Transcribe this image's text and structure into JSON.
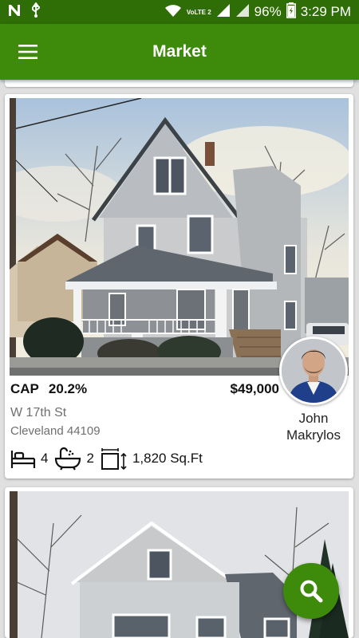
{
  "status_bar": {
    "network_label": "VoLTE 2",
    "battery": "96%",
    "time": "3:29 PM"
  },
  "app_bar": {
    "title": "Market",
    "menu_icon": "hamburger-menu-icon"
  },
  "listings": [
    {
      "cap_label": "CAP",
      "cap_value": "20.2%",
      "price": "$49,000",
      "street": "W 17th St",
      "city": "Cleveland 44109",
      "beds": "4",
      "baths": "2",
      "area": "1,820 Sq.Ft",
      "agent": {
        "first_name": "John",
        "last_name": "Makrylos"
      }
    },
    {}
  ],
  "fab": {
    "icon": "search-icon"
  },
  "colors": {
    "primary": "#3e8a0b",
    "primary_dark": "#2f6e06"
  }
}
